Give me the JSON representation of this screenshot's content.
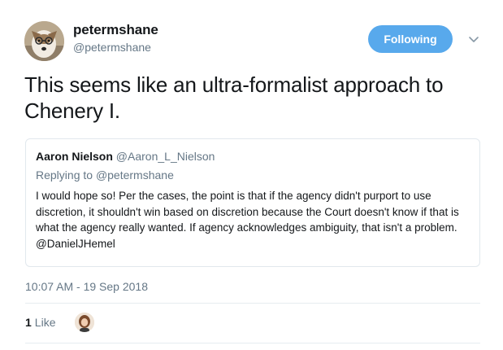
{
  "author": {
    "name": "petermshane",
    "handle": "@petermshane"
  },
  "follow_button": {
    "label": "Following",
    "color": "#58a9ec"
  },
  "menu_icon": "chevron-down-icon",
  "tweet": {
    "text": "This seems like an ultra-formalist approach to Chenery I."
  },
  "quoted_tweet": {
    "author_name": "Aaron Nielson",
    "author_handle": "@Aaron_L_Nielson",
    "replying_prefix": "Replying to ",
    "replying_to": "@petermshane",
    "text": "I would hope so! Per the cases, the point is that if the agency didn't purport to use discretion, it shouldn't win based on discretion because the Court doesn't know if that is what the agency really wanted. If agency acknowledges ambiguity, that isn't a problem. @DanielJHemel"
  },
  "timestamp": "10:07 AM - 19 Sep 2018",
  "likes": {
    "count": "1",
    "label": "Like"
  },
  "colors": {
    "text_primary": "#14171a",
    "text_secondary": "#657786",
    "border": "#e1e8ed"
  }
}
